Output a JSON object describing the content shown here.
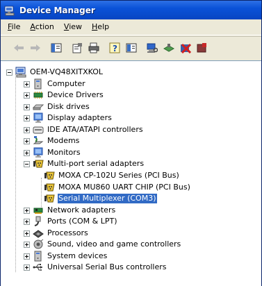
{
  "window": {
    "title": "Device Manager"
  },
  "menu": [
    {
      "key": "F",
      "rest": "ile"
    },
    {
      "key": "A",
      "rest": "ction"
    },
    {
      "key": "V",
      "rest": "iew"
    },
    {
      "key": "H",
      "rest": "elp"
    }
  ],
  "tree": {
    "root": "OEM-VQ48XITXKOL",
    "categories": [
      {
        "label": "Computer",
        "icon": "computer-icon"
      },
      {
        "label": "Device Drivers",
        "icon": "chip-icon"
      },
      {
        "label": "Disk drives",
        "icon": "disk-icon"
      },
      {
        "label": "Display adapters",
        "icon": "monitor-icon"
      },
      {
        "label": "IDE ATA/ATAPI controllers",
        "icon": "ide-icon"
      },
      {
        "label": "Modems",
        "icon": "modem-icon"
      },
      {
        "label": "Monitors",
        "icon": "monitor-icon"
      },
      {
        "label": "Multi-port serial adapters",
        "icon": "serial-port-icon"
      },
      {
        "label": "Network adapters",
        "icon": "network-card-icon"
      },
      {
        "label": "Ports (COM & LPT)",
        "icon": "port-icon"
      },
      {
        "label": "Processors",
        "icon": "processor-icon"
      },
      {
        "label": "Sound, video and game controllers",
        "icon": "sound-icon"
      },
      {
        "label": "System devices",
        "icon": "system-icon"
      },
      {
        "label": "Universal Serial Bus controllers",
        "icon": "usb-icon"
      }
    ],
    "serial_children": [
      {
        "label": "MOXA CP-102U Series (PCI Bus)"
      },
      {
        "label": "MOXA MU860 UART CHIP (PCI Bus)"
      },
      {
        "label": "Serial Multiplexer (COM3)",
        "selected": true
      }
    ]
  },
  "colors": {
    "title_bar": "#0a52d8",
    "selection": "#316ac5",
    "chrome": "#ece9d8"
  }
}
